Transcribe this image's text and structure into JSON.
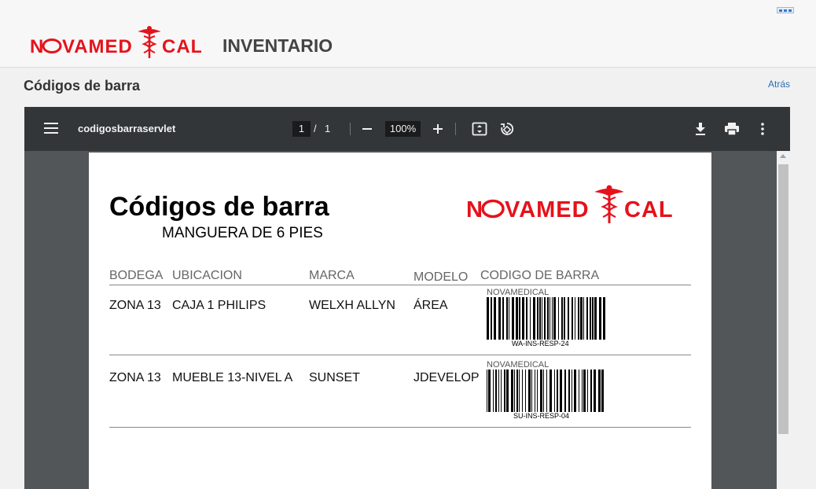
{
  "header": {
    "logo_text": "NOVAMEDICAL",
    "app_title": "INVENTARIO"
  },
  "subheader": {
    "title": "Códigos de barra",
    "back_label": "Atrás"
  },
  "viewer": {
    "filename": "codigosbarraservlet",
    "current_page": "1",
    "page_separator": "/",
    "total_pages": "1",
    "zoom": "100%",
    "icons": [
      "menu-icon",
      "zoom-out-icon",
      "zoom-in-icon",
      "fit-page-icon",
      "rotate-icon",
      "download-icon",
      "print-icon",
      "more-icon"
    ]
  },
  "document": {
    "title": "Códigos de barra",
    "subtitle": "MANGUERA DE 6 PIES",
    "columns": [
      "BODEGA",
      "UBICACION",
      "MARCA",
      "MODELO",
      "CODIGO DE BARRA"
    ],
    "rows": [
      {
        "bodega": "ZONA 13",
        "ubicacion": "CAJA 1 PHILIPS",
        "marca": "WELXH ALLYN",
        "modelo": "ÁREA",
        "barcode_label": "NOVAMEDICAL",
        "barcode_code": "WA-INS-RESP-24"
      },
      {
        "bodega": "ZONA 13",
        "ubicacion": "MUEBLE 13-NIVEL A",
        "marca": "SUNSET",
        "modelo": "JDEVELOP",
        "barcode_label": "NOVAMEDICAL",
        "barcode_code": "SU-INS-RESP-04"
      }
    ]
  },
  "colors": {
    "brand_red": "#e5121b",
    "toolbar_bg": "#323639",
    "viewer_bg": "#525659",
    "link_blue": "#2a6fb5"
  }
}
